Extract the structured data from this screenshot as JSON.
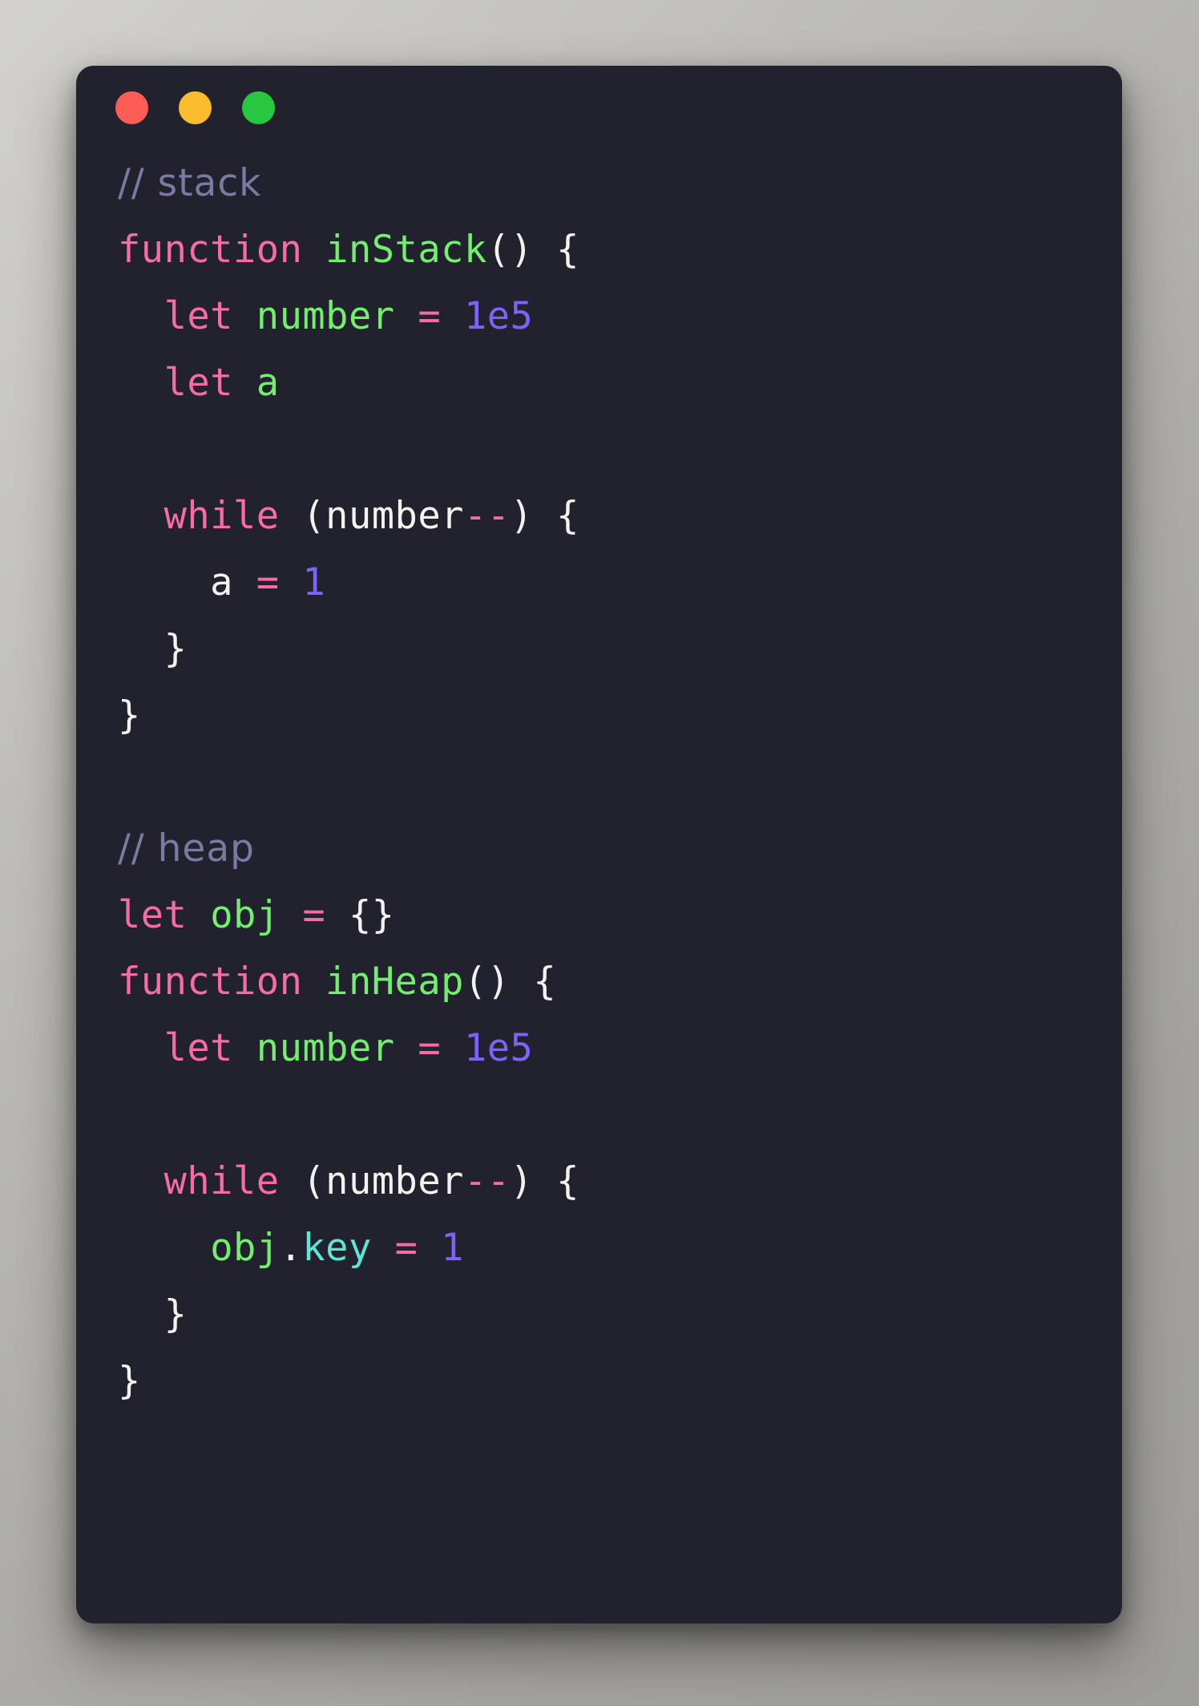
{
  "window": {
    "name": "code-snippet-window",
    "traffic_lights": [
      {
        "name": "close-button",
        "color": "#fc5d55"
      },
      {
        "name": "minimize-button",
        "color": "#fdbc2e"
      },
      {
        "name": "maximize-button",
        "color": "#27c83f"
      }
    ],
    "background": "#22222e",
    "page_background": "#adaca8"
  },
  "theme": {
    "comment": "#7b7aa3",
    "keyword": "#f96ba3",
    "function": "#74ee6e",
    "variable": "#74ee6e",
    "number": "#7d63f7",
    "operator": "#f96ba3",
    "plain": "#f4f2ef",
    "property": "#5ce6d4"
  },
  "code": {
    "language": "javascript",
    "lines": [
      {
        "id": "l01",
        "tokens": [
          {
            "t": "// stack",
            "c": "cm"
          }
        ]
      },
      {
        "id": "l02",
        "tokens": [
          {
            "t": "function",
            "c": "kw"
          },
          {
            "t": " ",
            "c": "pl"
          },
          {
            "t": "inStack",
            "c": "fn"
          },
          {
            "t": "() {",
            "c": "pl"
          }
        ]
      },
      {
        "id": "l03",
        "tokens": [
          {
            "t": "  ",
            "c": "pl"
          },
          {
            "t": "let",
            "c": "kw"
          },
          {
            "t": " ",
            "c": "pl"
          },
          {
            "t": "number",
            "c": "var"
          },
          {
            "t": " ",
            "c": "pl"
          },
          {
            "t": "=",
            "c": "op"
          },
          {
            "t": " ",
            "c": "pl"
          },
          {
            "t": "1e5",
            "c": "num"
          }
        ]
      },
      {
        "id": "l04",
        "tokens": [
          {
            "t": "  ",
            "c": "pl"
          },
          {
            "t": "let",
            "c": "kw"
          },
          {
            "t": " ",
            "c": "pl"
          },
          {
            "t": "a",
            "c": "var"
          }
        ]
      },
      {
        "id": "l05",
        "tokens": [
          {
            "t": "",
            "c": "pl"
          }
        ]
      },
      {
        "id": "l06",
        "tokens": [
          {
            "t": "  ",
            "c": "pl"
          },
          {
            "t": "while",
            "c": "kw"
          },
          {
            "t": " (",
            "c": "pl"
          },
          {
            "t": "number",
            "c": "pl"
          },
          {
            "t": "--",
            "c": "op"
          },
          {
            "t": ") {",
            "c": "pl"
          }
        ]
      },
      {
        "id": "l07",
        "tokens": [
          {
            "t": "    a ",
            "c": "pl"
          },
          {
            "t": "=",
            "c": "op"
          },
          {
            "t": " ",
            "c": "pl"
          },
          {
            "t": "1",
            "c": "num"
          }
        ]
      },
      {
        "id": "l08",
        "tokens": [
          {
            "t": "  }",
            "c": "pl"
          }
        ]
      },
      {
        "id": "l09",
        "tokens": [
          {
            "t": "}",
            "c": "pl"
          }
        ]
      },
      {
        "id": "l10",
        "tokens": [
          {
            "t": "",
            "c": "pl"
          }
        ]
      },
      {
        "id": "l11",
        "tokens": [
          {
            "t": "// heap",
            "c": "cm"
          }
        ]
      },
      {
        "id": "l12",
        "tokens": [
          {
            "t": "let",
            "c": "kw"
          },
          {
            "t": " ",
            "c": "pl"
          },
          {
            "t": "obj",
            "c": "var"
          },
          {
            "t": " ",
            "c": "pl"
          },
          {
            "t": "=",
            "c": "op"
          },
          {
            "t": " ",
            "c": "pl"
          },
          {
            "t": "{}",
            "c": "pl"
          }
        ]
      },
      {
        "id": "l13",
        "tokens": [
          {
            "t": "function",
            "c": "kw"
          },
          {
            "t": " ",
            "c": "pl"
          },
          {
            "t": "inHeap",
            "c": "fn"
          },
          {
            "t": "() {",
            "c": "pl"
          }
        ]
      },
      {
        "id": "l14",
        "tokens": [
          {
            "t": "  ",
            "c": "pl"
          },
          {
            "t": "let",
            "c": "kw"
          },
          {
            "t": " ",
            "c": "pl"
          },
          {
            "t": "number",
            "c": "var"
          },
          {
            "t": " ",
            "c": "pl"
          },
          {
            "t": "=",
            "c": "op"
          },
          {
            "t": " ",
            "c": "pl"
          },
          {
            "t": "1e5",
            "c": "num"
          }
        ]
      },
      {
        "id": "l15",
        "tokens": [
          {
            "t": "",
            "c": "pl"
          }
        ]
      },
      {
        "id": "l16",
        "tokens": [
          {
            "t": "  ",
            "c": "pl"
          },
          {
            "t": "while",
            "c": "kw"
          },
          {
            "t": " (",
            "c": "pl"
          },
          {
            "t": "number",
            "c": "pl"
          },
          {
            "t": "--",
            "c": "op"
          },
          {
            "t": ") {",
            "c": "pl"
          }
        ]
      },
      {
        "id": "l17",
        "tokens": [
          {
            "t": "    ",
            "c": "pl"
          },
          {
            "t": "obj",
            "c": "var"
          },
          {
            "t": ".",
            "c": "pl"
          },
          {
            "t": "key",
            "c": "prop"
          },
          {
            "t": " ",
            "c": "pl"
          },
          {
            "t": "=",
            "c": "op"
          },
          {
            "t": " ",
            "c": "pl"
          },
          {
            "t": "1",
            "c": "num"
          }
        ]
      },
      {
        "id": "l18",
        "tokens": [
          {
            "t": "  }",
            "c": "pl"
          }
        ]
      },
      {
        "id": "l19",
        "tokens": [
          {
            "t": "}",
            "c": "pl"
          }
        ]
      }
    ]
  }
}
